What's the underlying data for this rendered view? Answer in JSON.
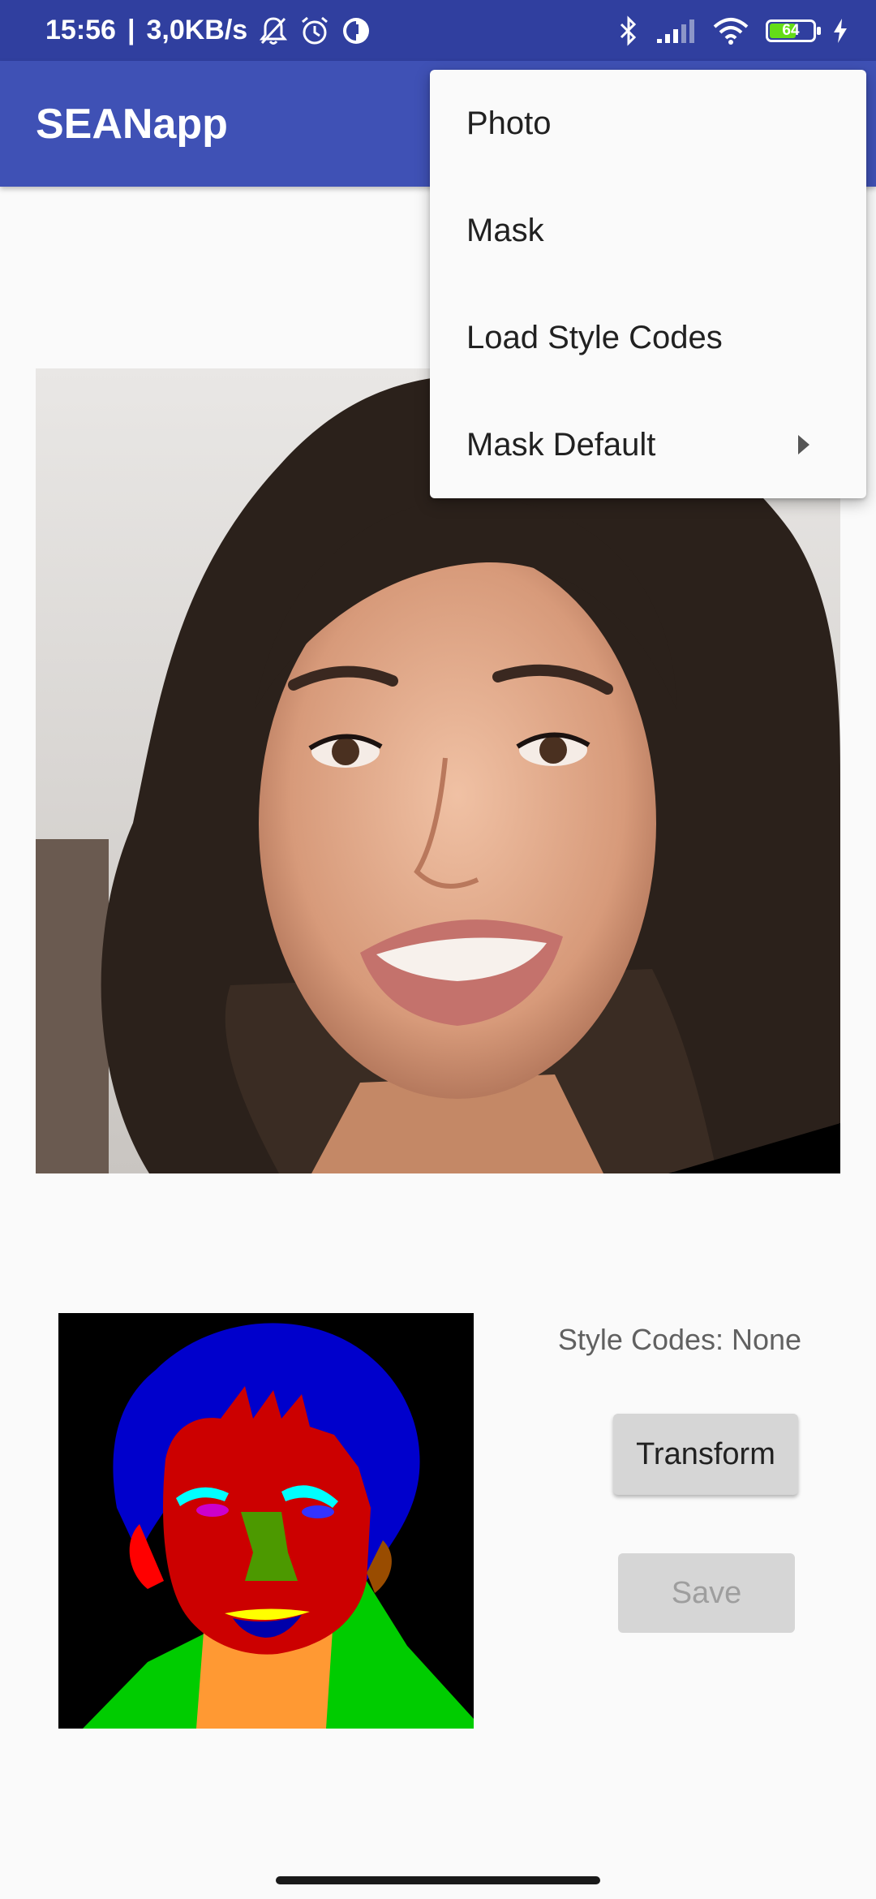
{
  "status_bar": {
    "time": "15:56",
    "separator": "|",
    "network_speed": "3,0KB/s",
    "icons": [
      "notifications-off-icon",
      "alarm-icon",
      "vpn-icon",
      "bluetooth-icon",
      "signal-icon",
      "wifi-icon",
      "battery-icon",
      "charging-icon"
    ],
    "battery_level": "64",
    "battery_fraction": 0.64,
    "battery_color": "#64dd17"
  },
  "app_bar": {
    "title": "SEANapp",
    "color": "#3f51b5"
  },
  "menu": {
    "items": [
      {
        "label": "Photo"
      },
      {
        "label": "Mask"
      },
      {
        "label": "Load Style Codes"
      },
      {
        "label": "Mask Default",
        "has_submenu": true
      }
    ]
  },
  "main": {
    "style_codes_label": "Style Codes: None",
    "transform_label": "Transform",
    "save_label": "Save",
    "save_enabled": false
  }
}
